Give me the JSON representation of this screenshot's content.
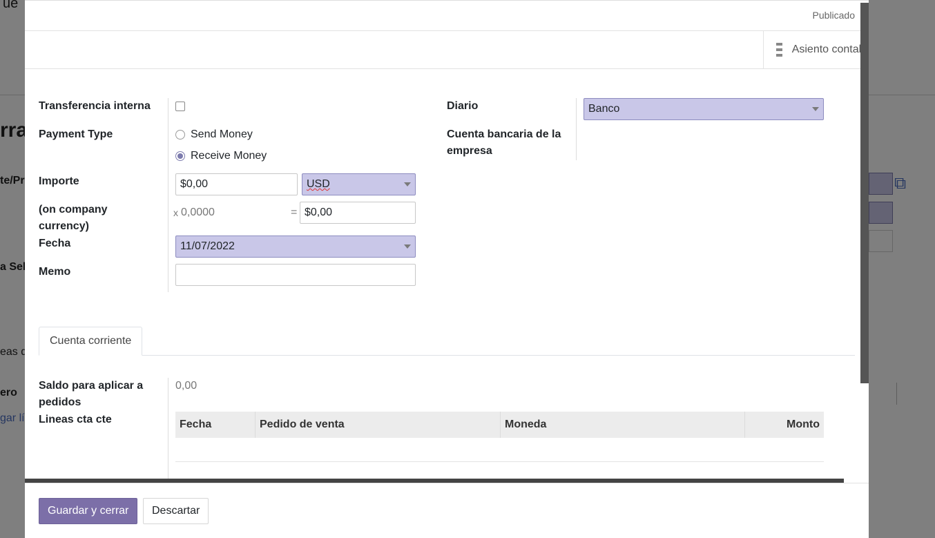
{
  "background": {
    "top_fragment": "ue",
    "big_fragment": "rra",
    "partner_fragment": "te/Pro",
    "select_fragment": "a Sel",
    "lines_fragment": "eas de",
    "money_fragment": "ero",
    "add_fragment": "gar lín"
  },
  "modal": {
    "status": "Publicado",
    "stat_button": "Asiento contable",
    "left_labels": {
      "internal_transfer": "Transferencia interna",
      "payment_type": "Payment Type",
      "amount": "Importe",
      "company_currency": "(on company currency)",
      "date": "Fecha",
      "memo": "Memo"
    },
    "payment_types": [
      "Send Money",
      "Receive Money"
    ],
    "amount_value": "$0,00",
    "currency": "USD",
    "rate_prefix": "x",
    "rate": "0,0000",
    "equals": "=",
    "company_amount": "$0,00",
    "date_value": "11/07/2022",
    "memo_value": "",
    "right_labels": {
      "journal": "Diario",
      "bank_account": "Cuenta bancaria de la empresa"
    },
    "journal_value": "Banco",
    "tab_label": "Cuenta corriente",
    "balance_label": "Saldo para aplicar a pedidos",
    "balance_value": "0,00",
    "lines_label": "Lineas cta cte",
    "table": {
      "columns": [
        "Fecha",
        "Pedido de venta",
        "Moneda",
        "Monto"
      ]
    },
    "save_label": "Guardar y cerrar",
    "discard_label": "Descartar"
  }
}
